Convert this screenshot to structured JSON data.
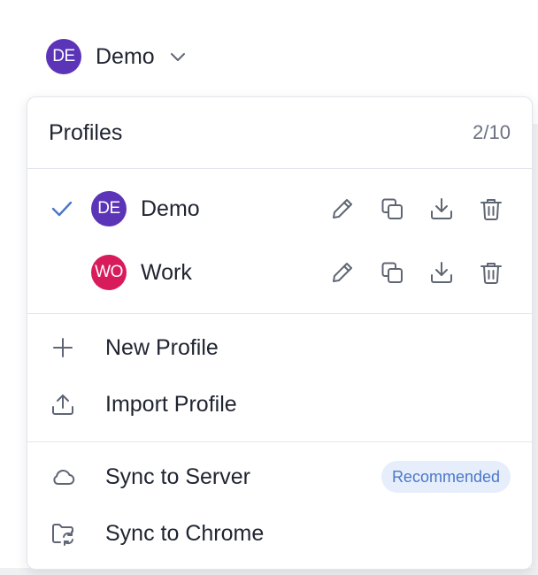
{
  "trigger": {
    "avatar_initials": "DE",
    "avatar_color": "#5b34b8",
    "name": "Demo",
    "icon": "chevron-down-icon"
  },
  "panel": {
    "title": "Profiles",
    "count": "2/10"
  },
  "profiles": [
    {
      "initials": "DE",
      "name": "Demo",
      "color": "#5b34b8",
      "selected": true
    },
    {
      "initials": "WO",
      "name": "Work",
      "color": "#d81b5b",
      "selected": false
    }
  ],
  "profile_actions": [
    "pencil-icon",
    "copy-icon",
    "download-icon",
    "trash-icon"
  ],
  "menu": {
    "new_profile": "New Profile",
    "import_profile": "Import Profile",
    "sync_server": "Sync to Server",
    "sync_server_badge": "Recommended",
    "sync_chrome": "Sync to Chrome"
  },
  "colors": {
    "accent": "#4a78c8",
    "check": "#4a78c8",
    "icon": "#5f6673",
    "badge_bg": "#e6eefb"
  }
}
